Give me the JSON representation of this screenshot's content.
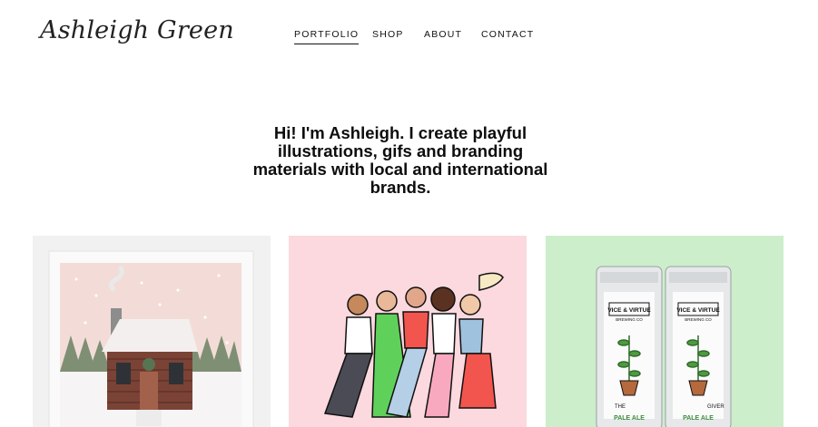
{
  "site": {
    "logo_text": "Ashleigh Green"
  },
  "nav": {
    "items": [
      {
        "label": "PORTFOLIO",
        "active": true
      },
      {
        "label": "SHOP",
        "active": false
      },
      {
        "label": "ABOUT",
        "active": false
      },
      {
        "label": "CONTACT",
        "active": false
      }
    ]
  },
  "intro": {
    "text": "Hi! I'm Ashleigh. I create playful illustrations, gifs and branding materials with local and international brands."
  },
  "portfolio": {
    "tiles": [
      {
        "subject": "cabin-in-snow-illustration",
        "background": "#f1f1f1"
      },
      {
        "subject": "group-of-women-illustration",
        "background": "#fbd9df"
      },
      {
        "subject": "beer-cans-packaging",
        "background": "#cdeecb"
      }
    ],
    "cans": {
      "brand": "VICE & VIRTUE",
      "sub": "BREWING CO",
      "name_left": "THE",
      "name_right": "GIVER",
      "style": "PALE ALE"
    }
  }
}
